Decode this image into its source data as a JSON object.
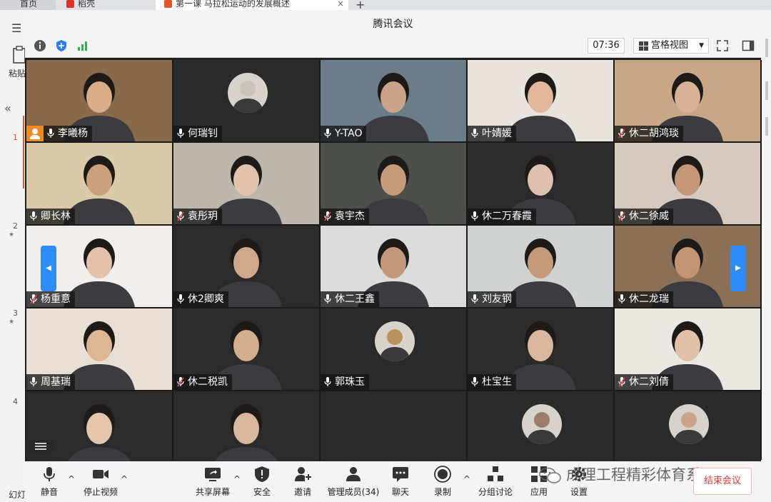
{
  "browser": {
    "tabs": [
      {
        "label": "首页",
        "color": "#2f6cd9"
      },
      {
        "label": "稻壳",
        "color": "#d9342b"
      },
      {
        "label": "第一课 马拉松运动的发展概述",
        "color": "#e2572a",
        "close": "×"
      }
    ],
    "new_tab": "+"
  },
  "doc_app": {
    "menu_glyph": "☰",
    "paste_label": "粘贴",
    "collapse_glyph": "«",
    "slide_numbers": [
      "1",
      "2",
      "3",
      "4"
    ],
    "slide_marks": [
      "★",
      "★"
    ],
    "bottom_label": "幻灯"
  },
  "meeting": {
    "title": "腾讯会议",
    "timer": "07:36",
    "view_mode": "宫格视图",
    "view_caret": "▼",
    "participants": [
      {
        "name": "李曦杨",
        "mic": "on",
        "host": true,
        "bg": "#8a6a4a",
        "skin": "#d9ad8a"
      },
      {
        "name": "何瑞钊",
        "mic": "on",
        "avatar": true,
        "bg": "#2a2a2a",
        "skin": "#c9c3bb"
      },
      {
        "name": "Y-TAO",
        "mic": "on",
        "bg": "#6b7d89",
        "skin": "#caa488"
      },
      {
        "name": "叶婧媛",
        "mic": "on",
        "bg": "#e8e3dc",
        "skin": "#e2b79b"
      },
      {
        "name": "休二胡鸿琰",
        "mic": "off",
        "bg": "#c7a785",
        "skin": "#d8b197"
      },
      {
        "name": "卿长林",
        "mic": "on",
        "bg": "#d9cba8",
        "skin": "#caa07e"
      },
      {
        "name": "袁彤玥",
        "mic": "off",
        "bg": "#bdb6ad",
        "skin": "#e1c3ae"
      },
      {
        "name": "袁宇杰",
        "mic": "off",
        "bg": "#4d4f4a",
        "skin": "#c69b7c"
      },
      {
        "name": "休二万春霞",
        "mic": "on",
        "bg": "#2b2b2b",
        "skin": "#ddc0ad"
      },
      {
        "name": "休二徐威",
        "mic": "off",
        "bg": "#d6cabf",
        "skin": "#c49877"
      },
      {
        "name": "杨重意",
        "mic": "off",
        "bg": "#f1efee",
        "skin": "#e2c2ab"
      },
      {
        "name": "休2卿爽",
        "mic": "on",
        "bg": "#2b2b2b",
        "skin": "#cfa78a"
      },
      {
        "name": "休二王鑫",
        "mic": "on",
        "bg": "#dcdcdc",
        "skin": "#c4987a"
      },
      {
        "name": "刘友钢",
        "mic": "on",
        "bg": "#cfd2d0",
        "skin": "#c59a7b"
      },
      {
        "name": "休二龙瑞",
        "mic": "on",
        "bg": "#8c6f57",
        "skin": "#c39574"
      },
      {
        "name": "周基瑞",
        "mic": "on",
        "bg": "#e7dfd3",
        "skin": "#dcb595"
      },
      {
        "name": "休二税凯",
        "mic": "off",
        "bg": "#2b2b2b",
        "skin": "#d3ab8f"
      },
      {
        "name": "郭珠玉",
        "mic": "on",
        "avatar": true,
        "bg": "#2a2a2a",
        "skin": "#b8935d"
      },
      {
        "name": "杜宝生",
        "mic": "on",
        "bg": "#2b2b2b",
        "skin": "#d8b69f"
      },
      {
        "name": "休二刘倩",
        "mic": "off",
        "bg": "#ebe7e3",
        "skin": "#e0c0a8"
      },
      {
        "name": "",
        "mic": "none",
        "bg": "#2b2b2b",
        "skin": "#e4c5ad"
      },
      {
        "name": "",
        "mic": "none",
        "bg": "#2b2b2b",
        "skin": "#d9b79f"
      },
      {
        "name": "",
        "mic": "none",
        "bg": "#2a2a2a",
        "skin": "#2a2a2a"
      },
      {
        "name": "",
        "mic": "none",
        "avatar": true,
        "bg": "#2a2a2a",
        "skin": "#9a7e6a"
      },
      {
        "name": "",
        "mic": "none",
        "avatar": true,
        "bg": "#2a2a2a",
        "skin": "#caa489"
      }
    ],
    "pager_left": "◀",
    "pager_right": "▶",
    "controls": {
      "mute": "静音",
      "stop_video": "停止视频",
      "share": "共享屏幕",
      "security": "安全",
      "invite": "邀请",
      "manage": "管理成员(34)",
      "chat": "聊天",
      "record": "录制",
      "breakout": "分组讨论",
      "apps": "应用",
      "settings": "设置",
      "end": "结束会议",
      "caret": "^"
    },
    "watermark": "成理工程精彩体育系"
  },
  "colors": {
    "accent": "#2f8cf7",
    "host": "#f08a24",
    "mic_off": "#e04a4a",
    "mic_on": "#ffffff",
    "end": "#e03b3b"
  }
}
